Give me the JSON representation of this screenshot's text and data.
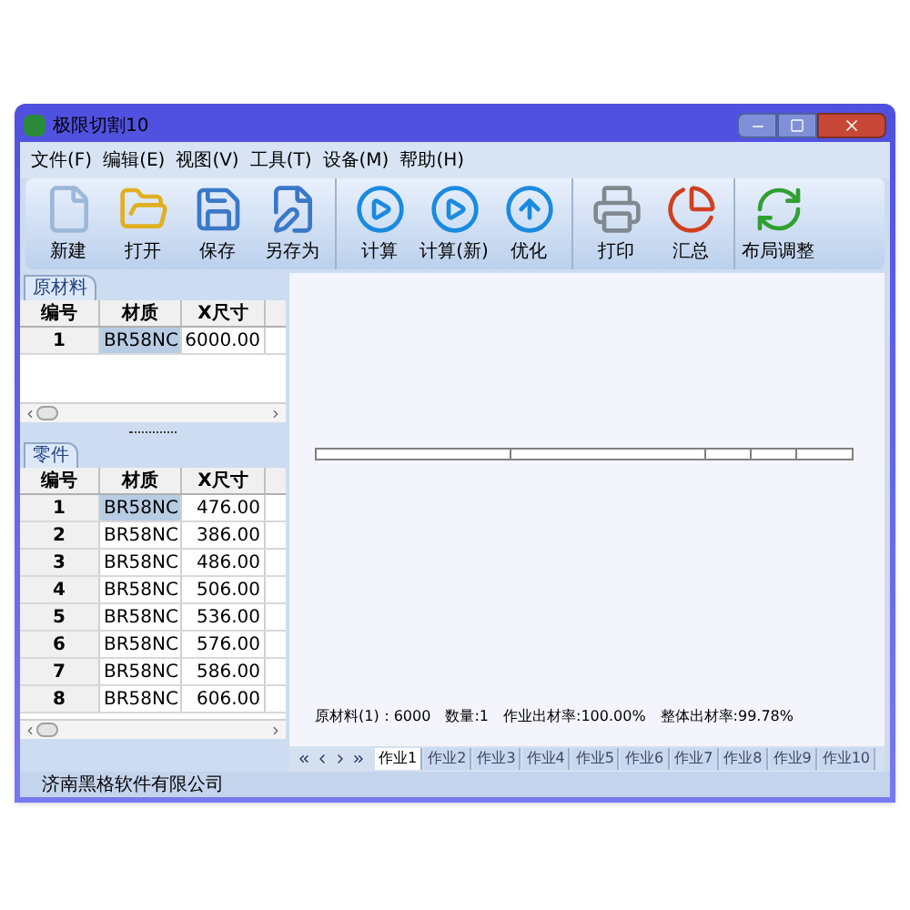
{
  "window": {
    "title": "极限切割10"
  },
  "menu": [
    "文件(F)",
    "编辑(E)",
    "视图(V)",
    "工具(T)",
    "设备(M)",
    "帮助(H)"
  ],
  "toolbar": [
    {
      "buttons": [
        "新建",
        "打开",
        "保存",
        "另存为"
      ]
    },
    {
      "buttons": [
        "计算",
        "计算(新)",
        "优化"
      ]
    },
    {
      "buttons": [
        "打印",
        "汇总"
      ]
    },
    {
      "buttons": [
        "布局调整"
      ]
    }
  ],
  "materials": {
    "tab": "原材料",
    "columns": [
      "编号",
      "材质",
      "X尺寸"
    ],
    "rows": [
      {
        "cells": [
          "1",
          "BR58NC",
          "6000.00"
        ],
        "selected": true
      }
    ]
  },
  "parts": {
    "tab": "零件",
    "columns": [
      "编号",
      "材质",
      "X尺寸"
    ],
    "rows": [
      {
        "cells": [
          "1",
          "BR58NC",
          "476.00"
        ],
        "selected": true
      },
      {
        "cells": [
          "2",
          "BR58NC",
          "386.00"
        ],
        "selected": false
      },
      {
        "cells": [
          "3",
          "BR58NC",
          "486.00"
        ],
        "selected": false
      },
      {
        "cells": [
          "4",
          "BR58NC",
          "506.00"
        ],
        "selected": false
      },
      {
        "cells": [
          "5",
          "BR58NC",
          "536.00"
        ],
        "selected": false
      },
      {
        "cells": [
          "6",
          "BR58NC",
          "576.00"
        ],
        "selected": false
      },
      {
        "cells": [
          "7",
          "BR58NC",
          "586.00"
        ],
        "selected": false
      },
      {
        "cells": [
          "8",
          "BR58NC",
          "606.00"
        ],
        "selected": false
      }
    ]
  },
  "canvas": {
    "summary": [
      "原材料(1)：6000",
      "数量:1",
      "作业出材率:100.00%",
      "整体出材率:99.78%"
    ]
  },
  "sheets": [
    {
      "label": "作业1",
      "selected": true
    },
    {
      "label": "作业2",
      "selected": false
    },
    {
      "label": "作业3",
      "selected": false
    },
    {
      "label": "作业4",
      "selected": false
    },
    {
      "label": "作业5",
      "selected": false
    },
    {
      "label": "作业6",
      "selected": false
    },
    {
      "label": "作业7",
      "selected": false
    },
    {
      "label": "作业8",
      "selected": false
    },
    {
      "label": "作业9",
      "selected": false
    },
    {
      "label": "作业10",
      "selected": false
    }
  ],
  "status_bar": "济南黑格软件有限公司"
}
